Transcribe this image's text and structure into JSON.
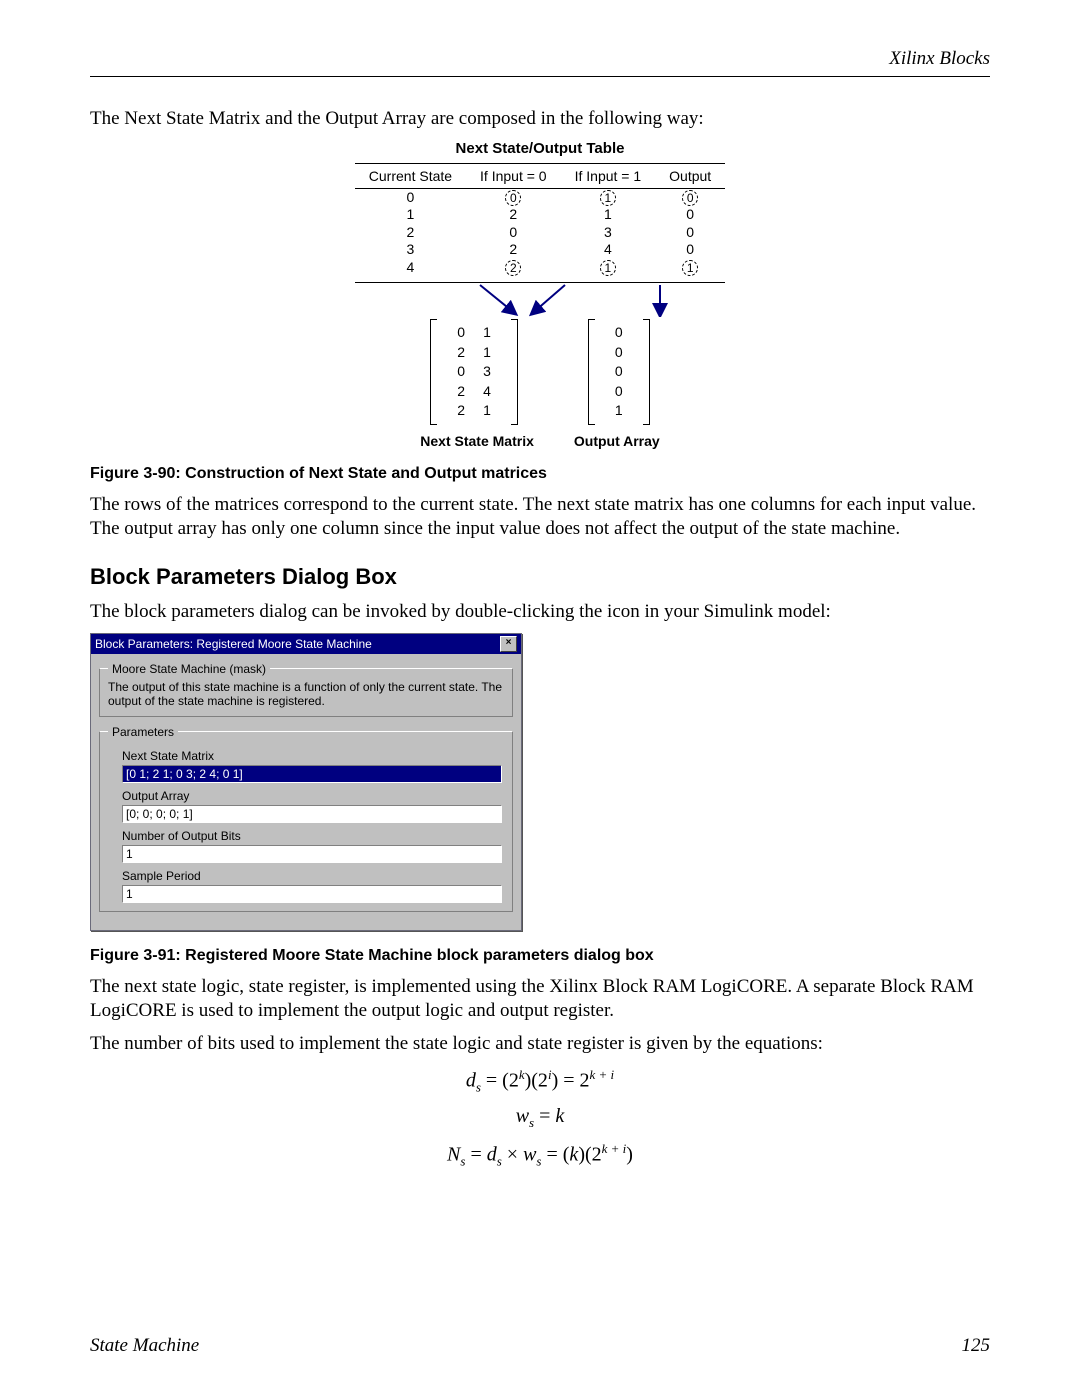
{
  "header": {
    "section": "Xilinx Blocks"
  },
  "intro": "The Next State Matrix and the Output Array are composed in the following way:",
  "fig90": {
    "title": "Next State/Output Table",
    "headers": [
      "Current State",
      "If Input = 0",
      "If Input = 1",
      "Output"
    ],
    "rows": [
      [
        "0",
        "0",
        "1",
        "0"
      ],
      [
        "1",
        "2",
        "1",
        "0"
      ],
      [
        "2",
        "0",
        "3",
        "0"
      ],
      [
        "3",
        "2",
        "4",
        "0"
      ],
      [
        "4",
        "2",
        "1",
        "1"
      ]
    ],
    "nsm_label": "Next State Matrix",
    "out_label": "Output Array",
    "caption": "Figure 3-90:   Construction of Next State and Output matrices"
  },
  "para1": "The rows of the matrices correspond to the current state.  The next state matrix has one columns for each input value. The output array has only one column since the input value does not affect the output of the state machine.",
  "h2": "Block Parameters Dialog Box",
  "para2": "The block parameters dialog can be invoked by double-clicking the icon in your Simulink model:",
  "dialog": {
    "title": "Block Parameters: Registered Moore State Machine",
    "mask_legend": "Moore State Machine (mask)",
    "mask_desc": "The output of this state machine is a function of only the current state. The output of the state machine is registered.",
    "params_legend": "Parameters",
    "fields": {
      "nsm": {
        "label": "Next State Matrix",
        "value": "[0 1; 2 1; 0 3; 2 4; 0 1]"
      },
      "out": {
        "label": "Output Array",
        "value": "[0; 0; 0; 0; 1]"
      },
      "bits": {
        "label": "Number of Output Bits",
        "value": "1"
      },
      "period": {
        "label": "Sample Period",
        "value": "1"
      }
    }
  },
  "fig91_caption": "Figure 3-91:   Registered Moore State Machine block parameters dialog box",
  "para3": "The next state logic, state register, is implemented using the Xilinx Block RAM LogiCORE. A separate Block RAM LogiCORE is used to implement the output logic and output register.",
  "para4": "The number of bits used to implement the state logic and state register is given by the equations:",
  "footer": {
    "left": "State Machine",
    "right": "125"
  },
  "chart_data": {
    "type": "table",
    "title": "Next State/Output Table",
    "columns": [
      "Current State",
      "If Input = 0",
      "If Input = 1",
      "Output"
    ],
    "rows": [
      [
        0,
        0,
        1,
        0
      ],
      [
        1,
        2,
        1,
        0
      ],
      [
        2,
        0,
        3,
        0
      ],
      [
        3,
        2,
        4,
        0
      ],
      [
        4,
        2,
        1,
        1
      ]
    ],
    "next_state_matrix": [
      [
        0,
        1
      ],
      [
        2,
        1
      ],
      [
        0,
        3
      ],
      [
        2,
        4
      ],
      [
        2,
        1
      ]
    ],
    "output_array": [
      0,
      0,
      0,
      0,
      1
    ]
  }
}
